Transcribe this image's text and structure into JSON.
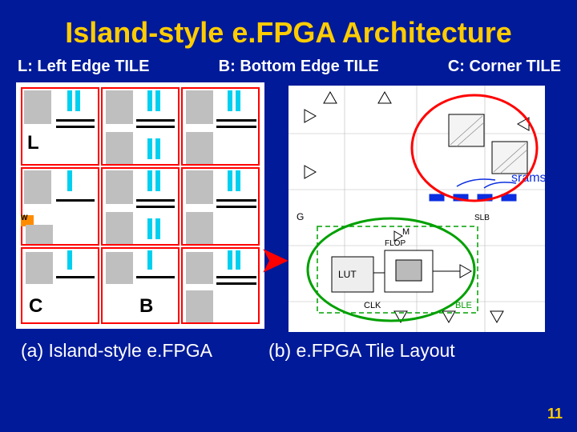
{
  "title": "Island-style e.FPGA Architecture",
  "legend": {
    "L": "L: Left Edge TILE",
    "B": "B: Bottom Edge TILE",
    "C": "C: Corner TILE"
  },
  "tiles": {
    "L_label": "L",
    "B_label": "B",
    "C_label": "C",
    "W_label": "W"
  },
  "captions": {
    "a": "(a) Island-style e.FPGA",
    "b": "(b) e.FPGA Tile Layout"
  },
  "figB": {
    "srams_label": "srams",
    "lut_label": "LUT",
    "ble_label": "BLE",
    "clk_label": "CLK",
    "slb_label": "SLB",
    "flop_label": "FLOP",
    "m_label": "M",
    "g_label": "G"
  },
  "page_number": "11",
  "chart_data": {
    "type": "diagram",
    "title": "Island-style e.FPGA Architecture",
    "figure_a": {
      "caption": "(a) Island-style e.FPGA",
      "grid": "3x3 red-bordered tiles",
      "tile_types": {
        "L": {
          "name": "Left Edge TILE",
          "positions": [
            [
              0,
              0
            ]
          ]
        },
        "C": {
          "name": "Corner TILE",
          "positions": [
            [
              2,
              0
            ]
          ]
        },
        "B": {
          "name": "Bottom Edge TILE",
          "positions": [
            [
              2,
              1
            ]
          ]
        },
        "standard": {
          "positions": [
            [
              0,
              1
            ],
            [
              0,
              2
            ],
            [
              1,
              0
            ],
            [
              1,
              1
            ],
            [
              1,
              2
            ],
            [
              2,
              2
            ]
          ]
        }
      },
      "W_channel_label": "W"
    },
    "figure_b": {
      "caption": "(b) e.FPGA Tile Layout",
      "annotations": [
        "srams",
        "LUT",
        "BLE",
        "CLK",
        "SLB",
        "FLOP",
        "M",
        "G"
      ],
      "highlight_circles": [
        "upper-right srams region (red)",
        "lower-left BLE region (green)"
      ],
      "srams_color": "blue",
      "ble_color": "green"
    }
  }
}
